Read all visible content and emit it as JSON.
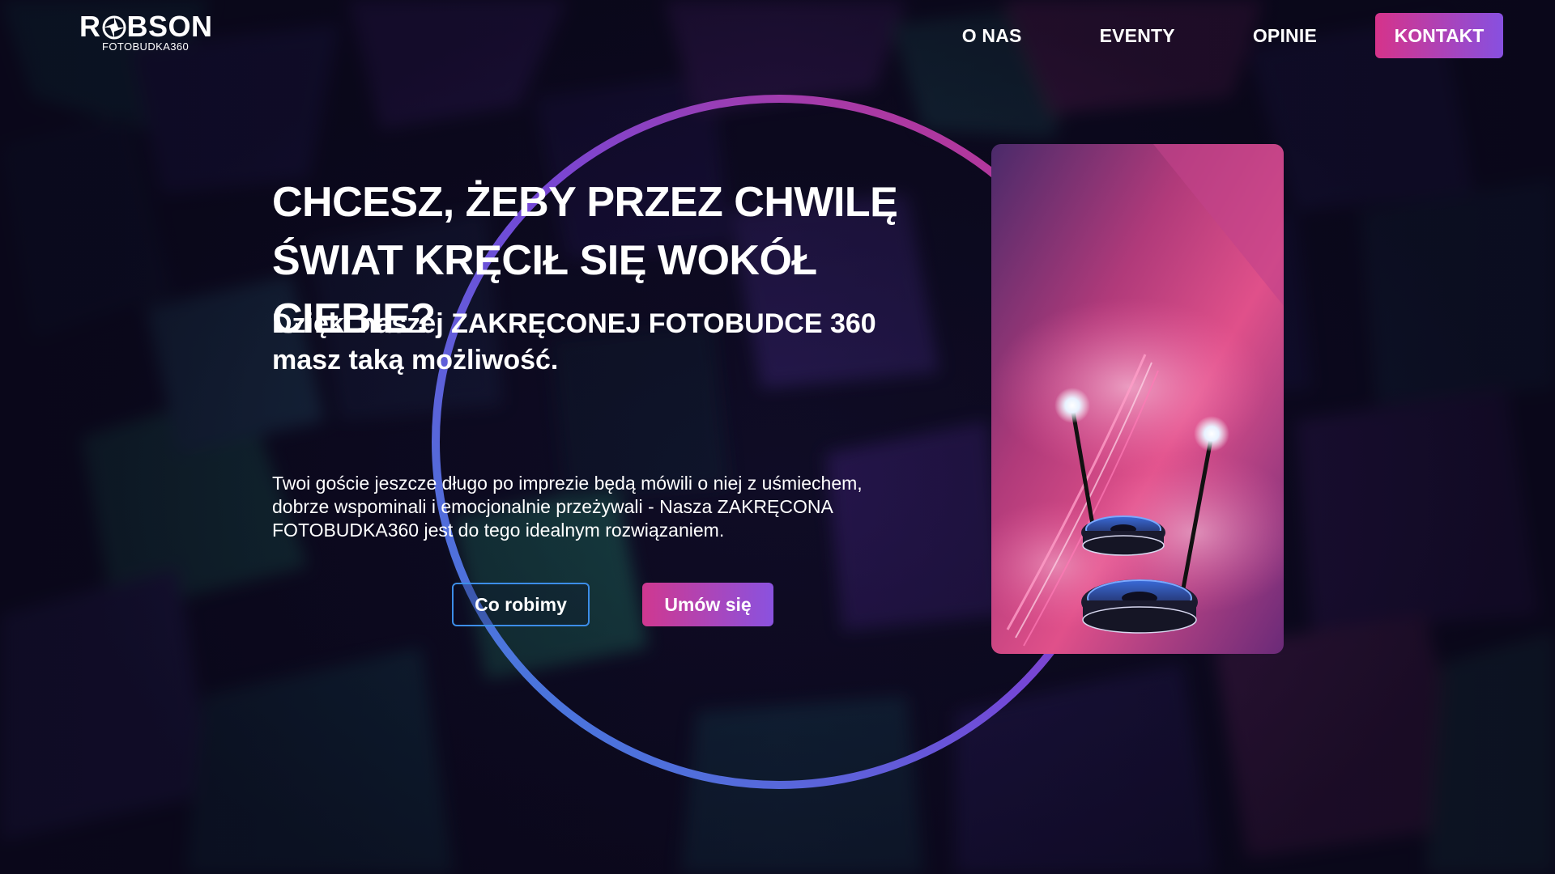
{
  "header": {
    "logo_text": "ROBSON",
    "logo_subtext": "FOTOBUDKA360",
    "nav": [
      {
        "label": "O NAS"
      },
      {
        "label": "EVENTY"
      },
      {
        "label": "OPINIE"
      }
    ],
    "cta_label": "KONTAKT"
  },
  "hero": {
    "title_lines": [
      "CHCESZ, ŻEBY PRZEZ CHWILĘ",
      "ŚWIAT KRĘCIŁ SIĘ WOKÓŁ CIEBIE?"
    ],
    "subtitle_lines": [
      "Dzięki naszej ZAKRĘCONEJ FOTOBUDCE 360",
      "masz taką możliwość."
    ],
    "body_lines": [
      "Twoi goście jeszcze długo po imprezie będą mówili o niej z uśmiechem,",
      "dobrze wspominali i emocjonalnie przeżywali - Nasza ZAKRĘCONA",
      "FOTOBUDKA360 jest do tego idealnym rozwiązaniem."
    ],
    "primary_button": "Co robimy",
    "secondary_button": "Umów się"
  },
  "colors": {
    "accent_pink": "#d6338a",
    "accent_purple": "#8750e0",
    "accent_blue": "#3c8de8"
  },
  "icons": {
    "logo_mark": "aperture-icon"
  }
}
